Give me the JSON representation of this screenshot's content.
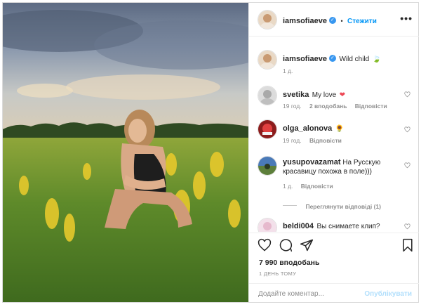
{
  "header": {
    "username": "iamsofiaeve",
    "verified": "✓",
    "separator": "•",
    "follow_label": "Стежити",
    "more_label": "•••"
  },
  "caption": {
    "username": "iamsofiaeve",
    "verified": "✓",
    "text": "Wild child",
    "emoji": "🍃",
    "time": "1 д."
  },
  "comments": [
    {
      "username": "svetika",
      "text": "My love",
      "emoji": "❤",
      "time": "19 год.",
      "likes": "2 вподобань",
      "reply": "Відповісти"
    },
    {
      "username": "olga_alonova",
      "text": "",
      "emoji": "🌻",
      "time": "19 год.",
      "likes": "",
      "reply": "Відповісти"
    },
    {
      "username": "yusupovazamat",
      "text": "На Русскую красавицу похожа в поле)))",
      "emoji": "",
      "time": "1 д.",
      "likes": "",
      "reply": "Відповісти"
    },
    {
      "username": "beldi004",
      "text": "Вы снимаете клип?",
      "emoji": "",
      "time": "",
      "likes": "",
      "reply": ""
    }
  ],
  "view_replies": "Переглянути відповіді (1)",
  "likes_count": "7 990 вподобань",
  "post_date": "1 ДЕНЬ ТОМУ",
  "add_comment": {
    "placeholder": "Додайте коментар...",
    "publish_label": "Опублікувати"
  },
  "colors": {
    "accent": "#0095f6",
    "publish_disabled": "#b2dffc",
    "heart": "#ed4956",
    "muted": "#8e8e8e"
  },
  "icons": [
    "heart-icon",
    "comment-icon",
    "share-icon",
    "bookmark-icon",
    "more-icon",
    "verified-badge-icon",
    "heart-like-icon"
  ]
}
